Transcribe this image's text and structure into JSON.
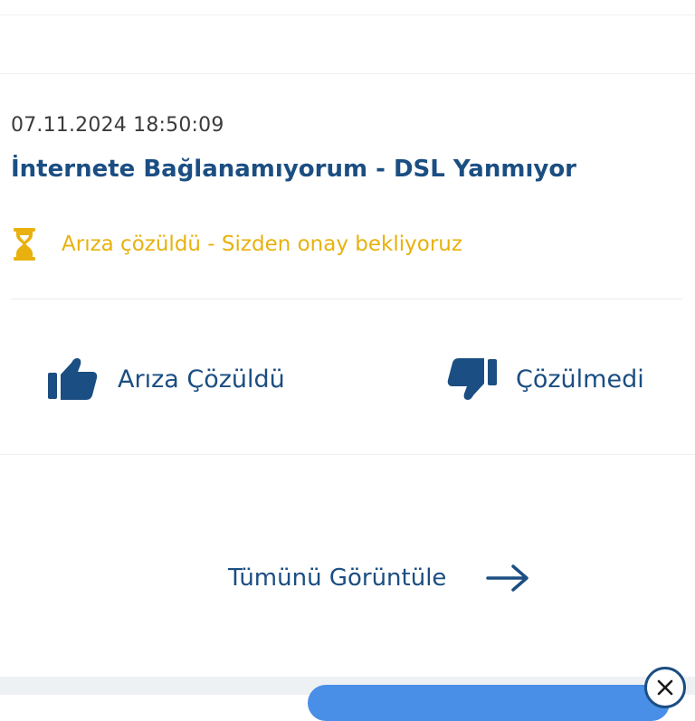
{
  "ticket": {
    "date": "07.11.2024 18:50:09",
    "title": "İnternete Bağlanamıyorum - DSL Yanmıyor",
    "status": {
      "text": "Arıza çözüldü - Sizden onay bekliyoruz",
      "icon": "hourglass-icon",
      "color": "#e8b10d"
    },
    "actions": {
      "resolved": {
        "label": "Arıza Çözüldü",
        "icon": "thumbs-up-icon"
      },
      "unresolved": {
        "label": "Çözülmedi",
        "icon": "thumbs-down-icon"
      }
    }
  },
  "view_all": {
    "label": "Tümünü Görüntüle",
    "icon": "arrow-right-icon"
  },
  "overlay": {
    "close_icon": "close-icon"
  },
  "colors": {
    "primary": "#1b4e82",
    "warning": "#e8b10d",
    "accent_button": "#4a8fe7"
  }
}
